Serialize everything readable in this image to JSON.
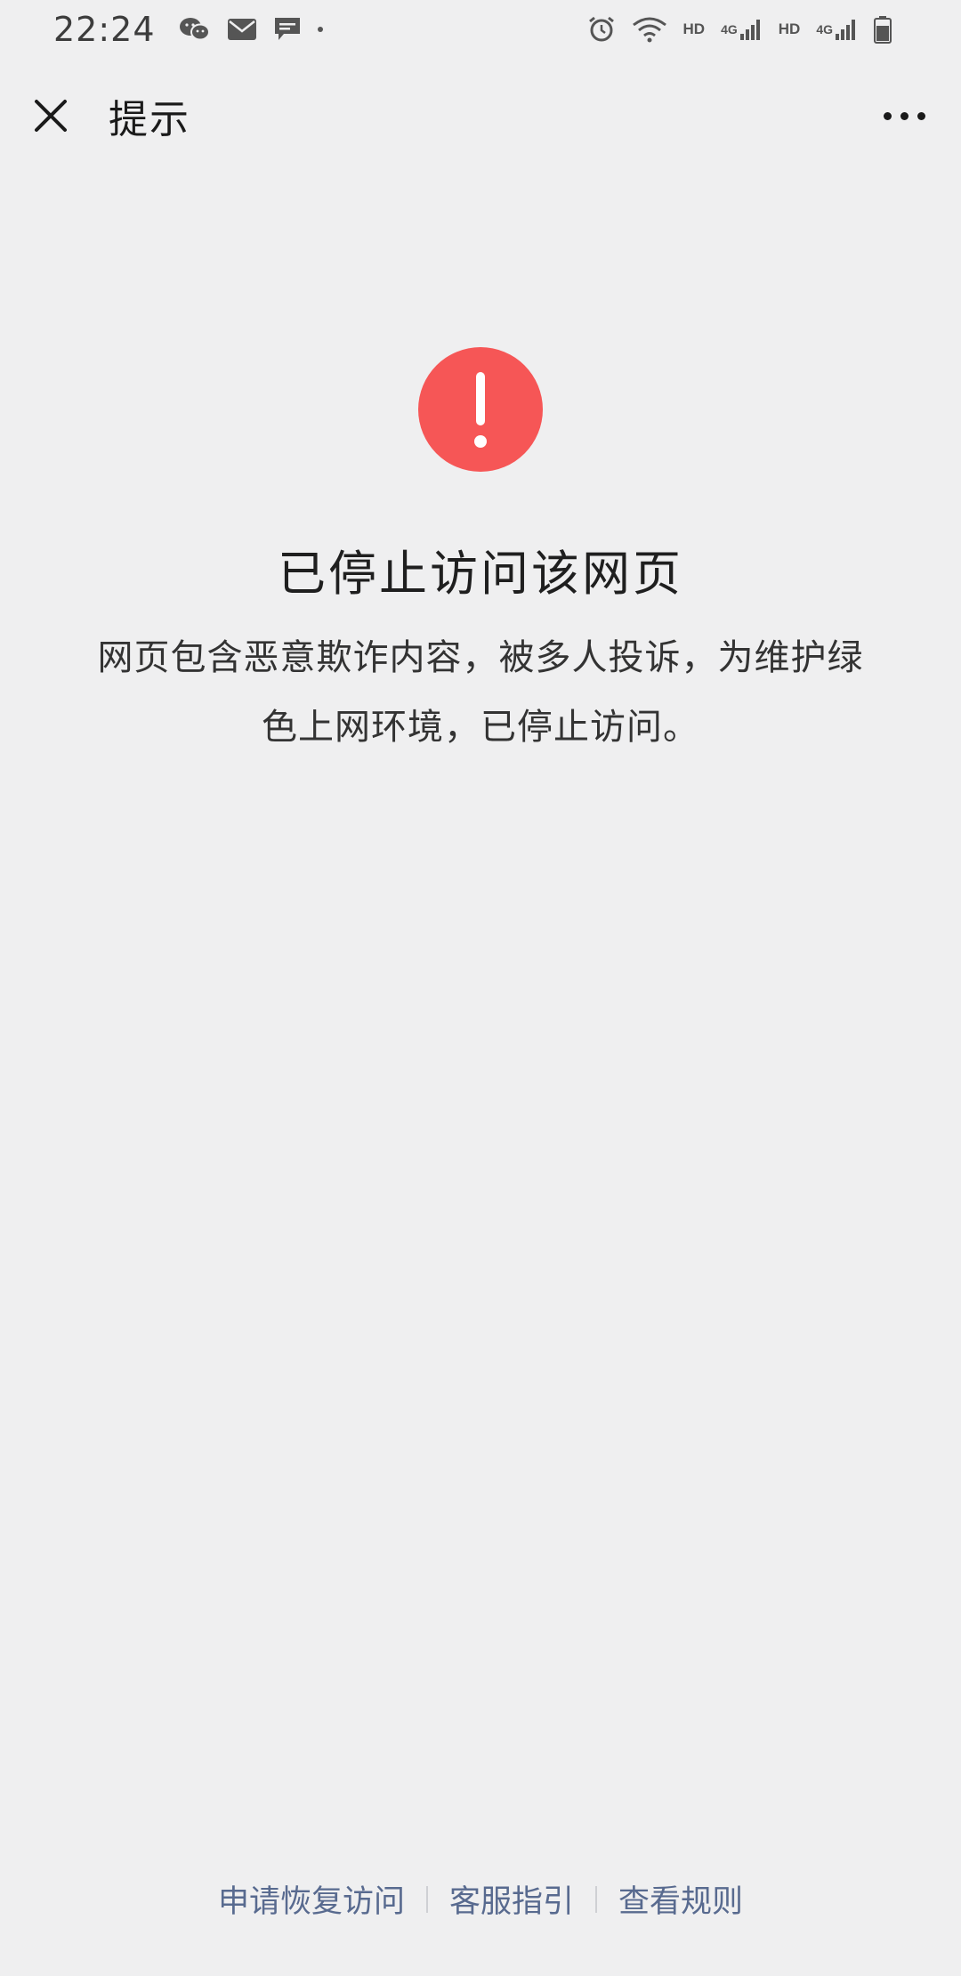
{
  "status_bar": {
    "time": "22:24",
    "left_icons": [
      "wechat-icon",
      "mail-icon",
      "message-icon",
      "dot-icon"
    ],
    "right_icons": [
      "alarm-icon",
      "wifi-icon",
      "hd-badge",
      "signal-4g-icon",
      "hd-badge",
      "signal-4g-icon",
      "battery-icon"
    ],
    "hd_label": "HD",
    "network_label": "4G"
  },
  "nav": {
    "title": "提示",
    "close_icon": "close-icon",
    "more_icon": "more-icon"
  },
  "warning": {
    "icon_glyph": "!",
    "icon_color": "#f65656",
    "headline": "已停止访问该网页",
    "description_line1": "网页包含恶意欺诈内容，被多人投诉，为维护绿",
    "description_line2": "色上网环境，已停止访问。"
  },
  "footer": {
    "links": [
      "申请恢复访问",
      "客服指引",
      "查看规则"
    ],
    "link_color": "#586a8f"
  }
}
